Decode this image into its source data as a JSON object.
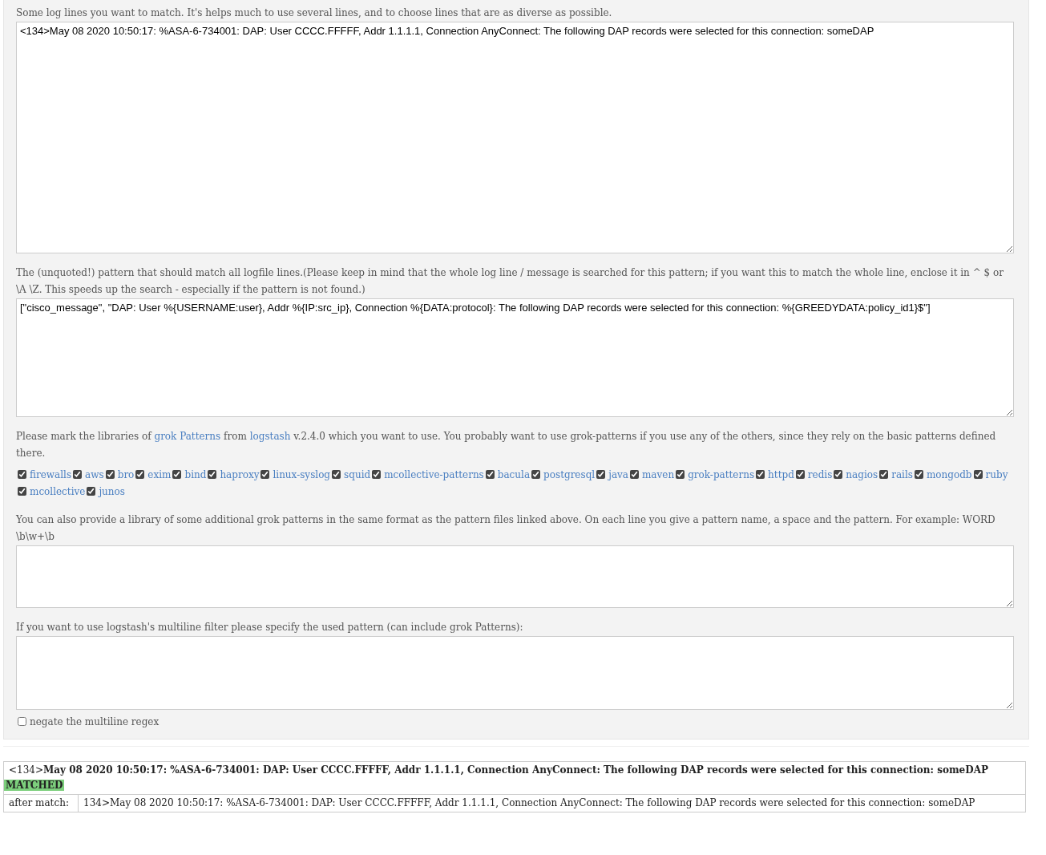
{
  "log_lines": {
    "label": "Some log lines you want to match. It's helps much to use several lines, and to choose lines that are as diverse as possible.",
    "value": "<134>May 08 2020 10:50:17: %ASA-6-734001: DAP: User CCCC.FFFFF, Addr 1.1.1.1, Connection AnyConnect: The following DAP records were selected for this connection: someDAP"
  },
  "pattern": {
    "label": "The (unquoted!) pattern that should match all logfile lines.(Please keep in mind that the whole log line / message is searched for this pattern; if you want this to match the whole line, enclose it in ^ $ or \\A \\Z. This speeds up the search - especially if the pattern is not found.)",
    "value": "[\"cisco_message\", \"DAP: User %{USERNAME:user}, Addr %{IP:src_ip}, Connection %{DATA:protocol}: The following DAP records were selected for this connection: %{GREEDYDATA:policy_id1}$\"]"
  },
  "libraries_intro": [
    {
      "kind": "text",
      "text": "Please mark the libraries of "
    },
    {
      "kind": "link",
      "text": "grok Patterns"
    },
    {
      "kind": "text",
      "text": " from "
    },
    {
      "kind": "link",
      "text": "logstash"
    },
    {
      "kind": "text",
      "text": " v.2.4.0 which you want to use. You probably want to use grok-patterns if you use any of the others, since they rely on the basic patterns defined there."
    }
  ],
  "libraries": [
    {
      "name": "firewalls",
      "checked": true
    },
    {
      "name": "aws",
      "checked": true
    },
    {
      "name": "bro",
      "checked": true
    },
    {
      "name": "exim",
      "checked": true
    },
    {
      "name": "bind",
      "checked": true
    },
    {
      "name": "haproxy",
      "checked": true
    },
    {
      "name": "linux-syslog",
      "checked": true
    },
    {
      "name": "squid",
      "checked": true
    },
    {
      "name": "mcollective-patterns",
      "checked": true
    },
    {
      "name": "bacula",
      "checked": true
    },
    {
      "name": "postgresql",
      "checked": true
    },
    {
      "name": "java",
      "checked": true
    },
    {
      "name": "maven",
      "checked": true
    },
    {
      "name": "grok-patterns",
      "checked": true
    },
    {
      "name": "httpd",
      "checked": true
    },
    {
      "name": "redis",
      "checked": true
    },
    {
      "name": "nagios",
      "checked": true
    },
    {
      "name": "rails",
      "checked": true
    },
    {
      "name": "mongodb",
      "checked": true
    },
    {
      "name": "ruby",
      "checked": true
    },
    {
      "name": "mcollective",
      "checked": true
    },
    {
      "name": "junos",
      "checked": true
    }
  ],
  "extra_patterns": {
    "label": "You can also provide a library of some additional grok patterns in the same format as the pattern files linked above. On each line you give a pattern name, a space and the pattern. For example: WORD \\b\\w+\\b"
  },
  "multiline": {
    "label": "If you want to use logstash's multiline filter please specify the used pattern (can include grok Patterns):"
  },
  "negate": {
    "label": "negate the multiline regex",
    "checked": false
  },
  "result": {
    "line": "<134>**May 08 2020 10:50:17: %ASA-6-734001: DAP: User CCCC.FFFFF, Addr 1.1.1.1, Connection AnyConnect: The following DAP records were selected for this connection: someDAP**",
    "status": "MATCHED",
    "rows": [
      {
        "key": "after match:",
        "value": "134>May 08 2020 10:50:17: %ASA-6-734001: DAP: User CCCC.FFFFF, Addr 1.1.1.1, Connection AnyConnect: The following DAP records were selected for this connection: someDAP"
      }
    ]
  }
}
